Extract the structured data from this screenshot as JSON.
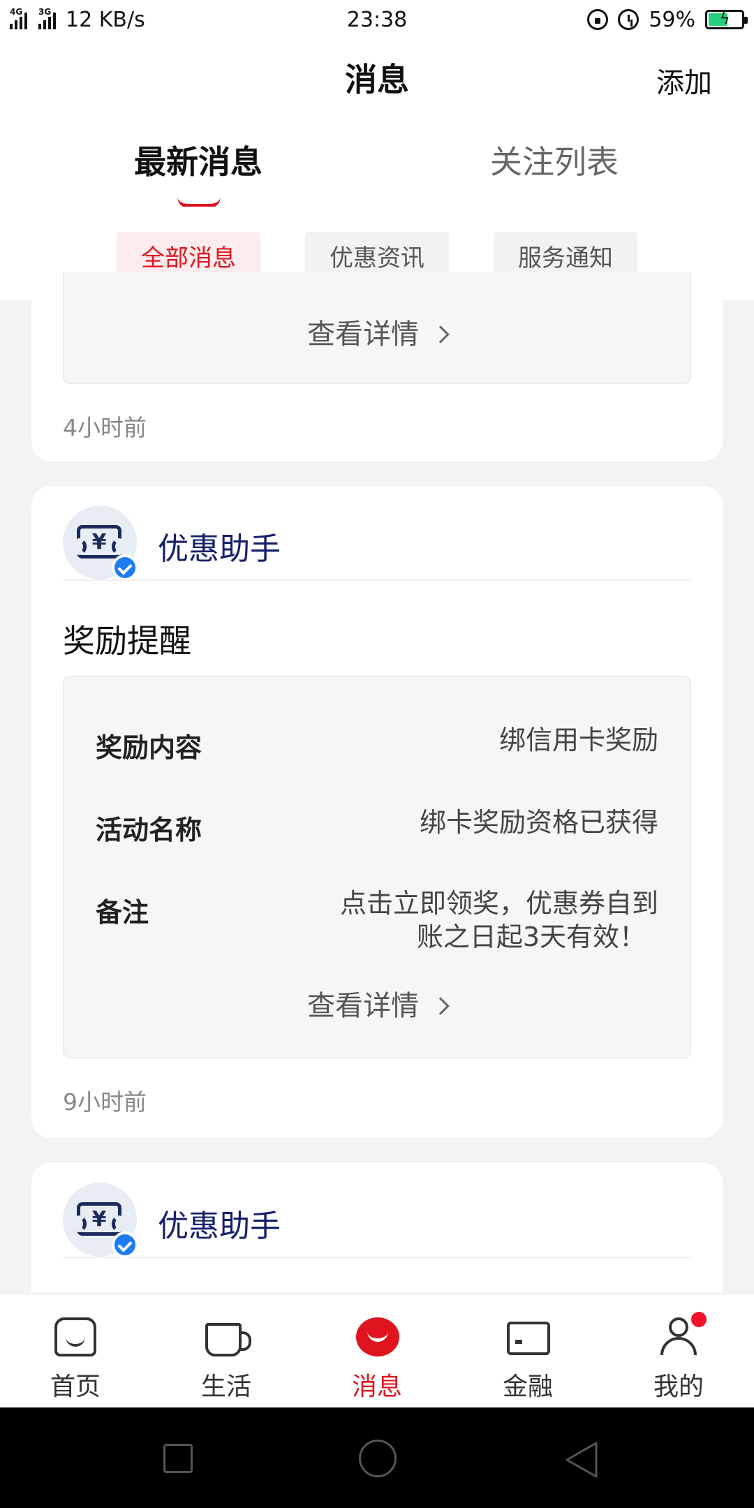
{
  "status_bar": {
    "network_tag_1": "4G",
    "network_tag_2": "3G",
    "speed": "12 KB/s",
    "time": "23:38",
    "battery": "59%",
    "battery_level": 0.59
  },
  "header": {
    "title": "消息",
    "action": "添加"
  },
  "main_tabs": [
    {
      "label": "最新消息",
      "active": true
    },
    {
      "label": "关注列表",
      "active": false
    }
  ],
  "sub_tabs": [
    {
      "label": "全部消息",
      "active": true
    },
    {
      "label": "优惠资讯",
      "active": false
    },
    {
      "label": "服务通知",
      "active": false
    }
  ],
  "cards": [
    {
      "view_more": "查看详情",
      "time": "4小时前"
    },
    {
      "sender": "优惠助手",
      "title": "奖励提醒",
      "rows": [
        {
          "label": "奖励内容",
          "value": "绑信用卡奖励"
        },
        {
          "label": "活动名称",
          "value": "绑卡奖励资格已获得"
        },
        {
          "label": "备注",
          "value_line1": "点击立即领奖，优惠券自到",
          "value_line2": "账之日起3天有效！"
        }
      ],
      "view_more": "查看详情",
      "time": "9小时前"
    },
    {
      "sender": "优惠助手"
    }
  ],
  "bottom_nav": [
    {
      "label": "首页",
      "icon": "home-icon"
    },
    {
      "label": "生活",
      "icon": "cup-icon"
    },
    {
      "label": "消息",
      "icon": "message-icon",
      "active": true
    },
    {
      "label": "金融",
      "icon": "card-icon"
    },
    {
      "label": "我的",
      "icon": "user-icon",
      "badge": true
    }
  ],
  "colors": {
    "accent": "#e0141e",
    "sender": "#15206b",
    "verified": "#1e7cf2"
  }
}
